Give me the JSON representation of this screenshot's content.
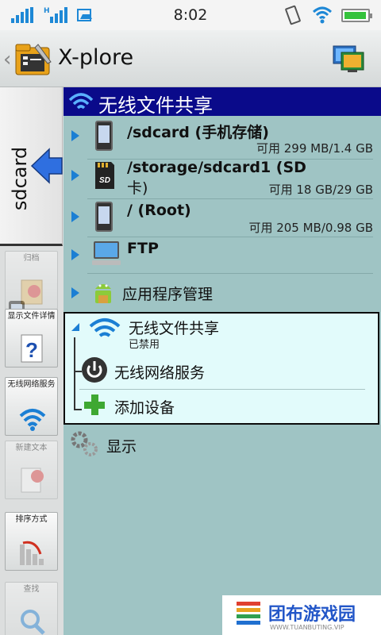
{
  "status_bar": {
    "time": "8:02"
  },
  "app": {
    "title": "X-plore"
  },
  "left_panel": {
    "tab_label": "sdcard",
    "buttons": [
      {
        "label": "归档",
        "icon": "archive-icon",
        "enabled": false
      },
      {
        "label": "显示文件详情",
        "icon": "file-details-icon",
        "enabled": true
      },
      {
        "label": "无线网络服务",
        "icon": "wifi-icon",
        "enabled": true
      },
      {
        "label": "新建文本",
        "icon": "new-text-icon",
        "enabled": false
      },
      {
        "label": "排序方式",
        "icon": "sort-icon",
        "enabled": true
      },
      {
        "label": "查找",
        "icon": "search-icon",
        "enabled": false
      }
    ]
  },
  "header": {
    "title": "无线文件共享"
  },
  "storage": [
    {
      "name": "/sdcard (手机存储)",
      "usage": "可用 299 MB/1.4 GB",
      "icon": "phone-icon"
    },
    {
      "name_line1": "/storage/sdcard1 (SD",
      "name_line2": "卡)",
      "usage": "可用 18 GB/29 GB",
      "icon": "sd-card-icon"
    },
    {
      "name": "/ (Root)",
      "usage": "可用 205 MB/0.98 GB",
      "icon": "phone-icon"
    },
    {
      "name": "FTP",
      "icon": "computer-icon"
    }
  ],
  "app_manager": {
    "label": "应用程序管理"
  },
  "wifi_share": {
    "title": "无线文件共享",
    "status": "已禁用",
    "service_label": "无线网络服务",
    "add_device_label": "添加设备"
  },
  "display": {
    "label": "显示"
  },
  "watermark": {
    "text": "团布游戏园",
    "sub": "WWW.TUANBUTING.VIP"
  },
  "colors": {
    "header_bg": "#0a0a8a",
    "pane_bg": "#9fc4c4",
    "panel_bg": "#e2fbfb",
    "accent": "#1b7fd4"
  }
}
